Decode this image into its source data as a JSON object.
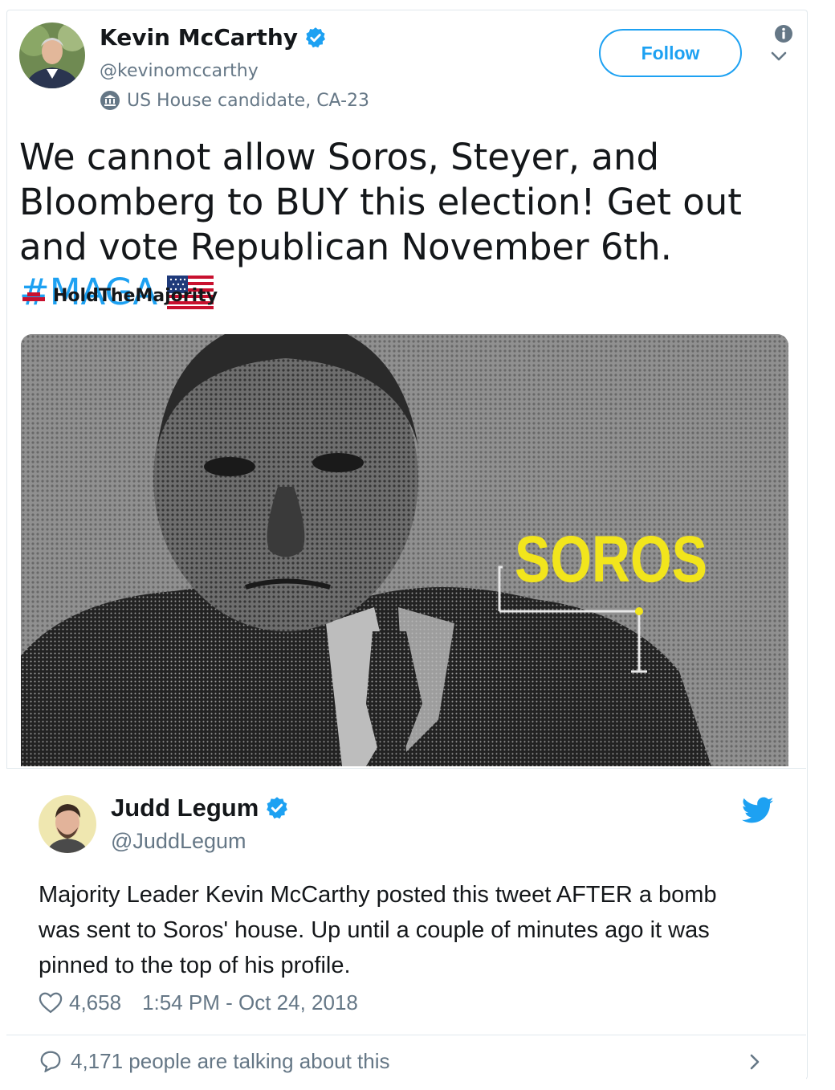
{
  "tweet": {
    "author": {
      "name": "Kevin McCarthy",
      "handle": "@kevinomccarthy",
      "label": "US House candidate, CA-23",
      "label_icon": "government-building-icon",
      "verified_icon": "verified-badge-icon",
      "avatar_icon": "avatar-photo"
    },
    "follow_label": "Follow",
    "text_before": "We cannot allow Soros, Steyer, and Bloomberg to BUY this election! Get out and vote Republican November 6th. ",
    "hashtag": "#MAGA",
    "emoji": "us-flag-icon",
    "source": {
      "name": "HoldTheMajority",
      "logo_icon": "hold-the-majority-logo"
    },
    "media": {
      "caption": "SOROS",
      "caption_color": "#f2e51c"
    }
  },
  "quoted": {
    "author": {
      "name": "Judd Legum",
      "handle": "@JuddLegum",
      "verified_icon": "verified-badge-icon",
      "avatar_icon": "avatar-photo"
    },
    "text": "Majority Leader Kevin McCarthy posted this tweet AFTER a bomb was sent to Soros' house. Up until a couple of minutes ago it was pinned to the top of his profile.",
    "likes": "4,658",
    "timestamp": "1:54 PM - Oct 24, 2018",
    "talking": "4,171 people are talking about this"
  },
  "colors": {
    "accent": "#1da1f2",
    "text": "#14171a",
    "muted": "#657786",
    "border": "#e1e8ed"
  }
}
